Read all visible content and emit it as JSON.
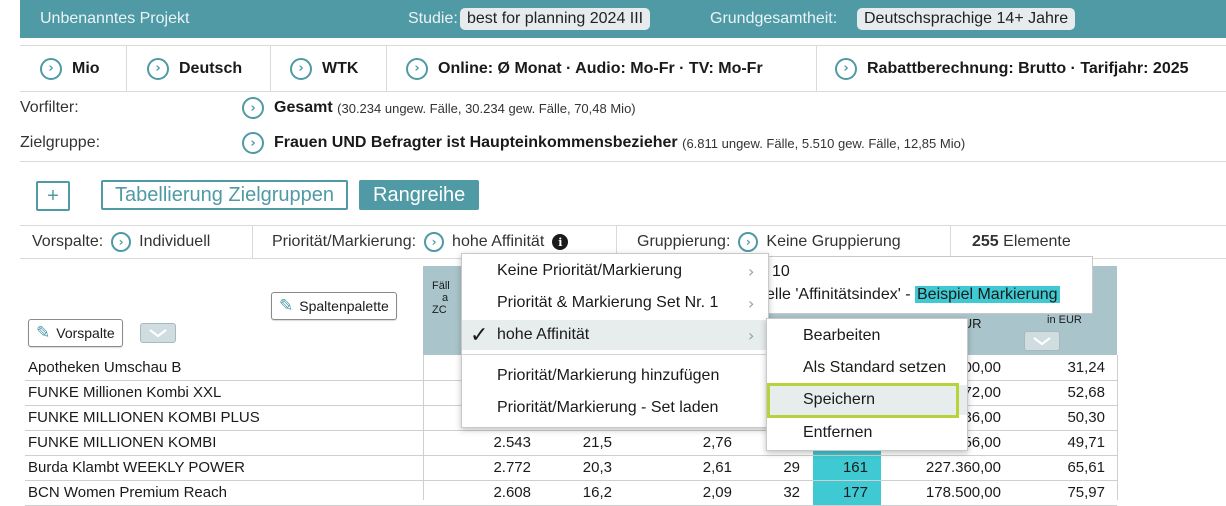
{
  "topbar": {
    "project": "Unbenanntes Projekt",
    "study_label": "Studie:",
    "study_value": "best for planning 2024 III",
    "population_label": "Grundgesamtheit:",
    "population_value": "Deutschsprachige 14+ Jahre"
  },
  "settings": {
    "tabs": [
      "Mio",
      "Deutsch",
      "WTK",
      "Online: Ø Monat · Audio: Mo-Fr · TV: Mo-Fr",
      "Rabattberechnung: Brutto · Tarifjahr: 2025"
    ],
    "vorfilter_label": "Vorfilter:",
    "vorfilter_value": "Gesamt",
    "vorfilter_detail": "(30.234 ungew. Fälle, 30.234 gew. Fälle, 70,48 Mio)",
    "zielgruppe_label": "Zielgruppe:",
    "zielgruppe_value": "Frauen UND Befragter ist Haupteinkommensbezieher",
    "zielgruppe_detail": "(6.811 ungew. Fälle, 5.510 gew. Fälle, 12,85 Mio)"
  },
  "actions": {
    "add": "+",
    "tabellierung": "Tabellierung Zielgruppen",
    "rangreihe": "Rangreihe"
  },
  "options": {
    "vorspalte_label": "Vorspalte:",
    "vorspalte_value": "Individuell",
    "prio_label": "Priorität/Markierung:",
    "prio_value": "hohe Affinität",
    "gruppierung_label": "Gruppierung:",
    "gruppierung_value": "Keine Gruppierung",
    "elemente_count": "255",
    "elemente_label": "Elemente"
  },
  "table_header": {
    "spaltenpalette": "Spaltenpalette",
    "vorspalte": "Vorspalte",
    "col1_lines": [
      "Fäll",
      "a",
      "ZC"
    ],
    "col_kosten": "Kosten EUR",
    "col_last": "in EUR"
  },
  "rows": [
    {
      "name": "Apotheken Umschau B",
      "c1": "",
      "c2": "",
      "c3": "",
      "c4": "",
      "c5": "",
      "c6": "00,00",
      "c7": "31,24"
    },
    {
      "name": "FUNKE Millionen Kombi XXL",
      "c1": "",
      "c2": "",
      "c3": "",
      "c4": "",
      "c5": "",
      "c6": "72,00",
      "c7": "52,68"
    },
    {
      "name": "FUNKE MILLIONEN KOMBI PLUS",
      "c1": "",
      "c2": "",
      "c3": "",
      "c4": "",
      "c5": "",
      "c6": "36,00",
      "c7": "50,30"
    },
    {
      "name": "FUNKE MILLIONEN KOMBI",
      "c1": "2.543",
      "c2": "21,5",
      "c3": "2,76",
      "c4": "",
      "c5": "",
      "c6": "56,00",
      "c7": "49,71"
    },
    {
      "name": "Burda Klambt WEEKLY POWER",
      "c1": "2.772",
      "c2": "20,3",
      "c3": "2,61",
      "c4": "29",
      "c5": "161",
      "c6": "227.360,00",
      "c7": "65,61"
    },
    {
      "name": "BCN Women Premium Reach",
      "c1": "2.608",
      "c2": "16,2",
      "c3": "2,09",
      "c4": "32",
      "c5": "177",
      "c6": "178.500,00",
      "c7": "75,97"
    }
  ],
  "menu": {
    "items": [
      "Keine Priorität/Markierung",
      "Priorität & Markierung Set Nr. 1",
      "hohe Affinität",
      "Priorität/Markierung hinzufügen",
      "Priorität/Markierung - Set laden"
    ]
  },
  "submenu": {
    "items": [
      "Bearbeiten",
      "Als Standard setzen",
      "Speichern",
      "Entfernen"
    ]
  },
  "tooltip": {
    "line1": "10",
    "line2_prefix": "elle 'Affinitätsindex' - ",
    "line2_mark": "Beispiel Markierung"
  },
  "colors": {
    "accent": "#4f9aa5",
    "highlight": "#3fc9d2",
    "focus": "#b8d23c"
  }
}
